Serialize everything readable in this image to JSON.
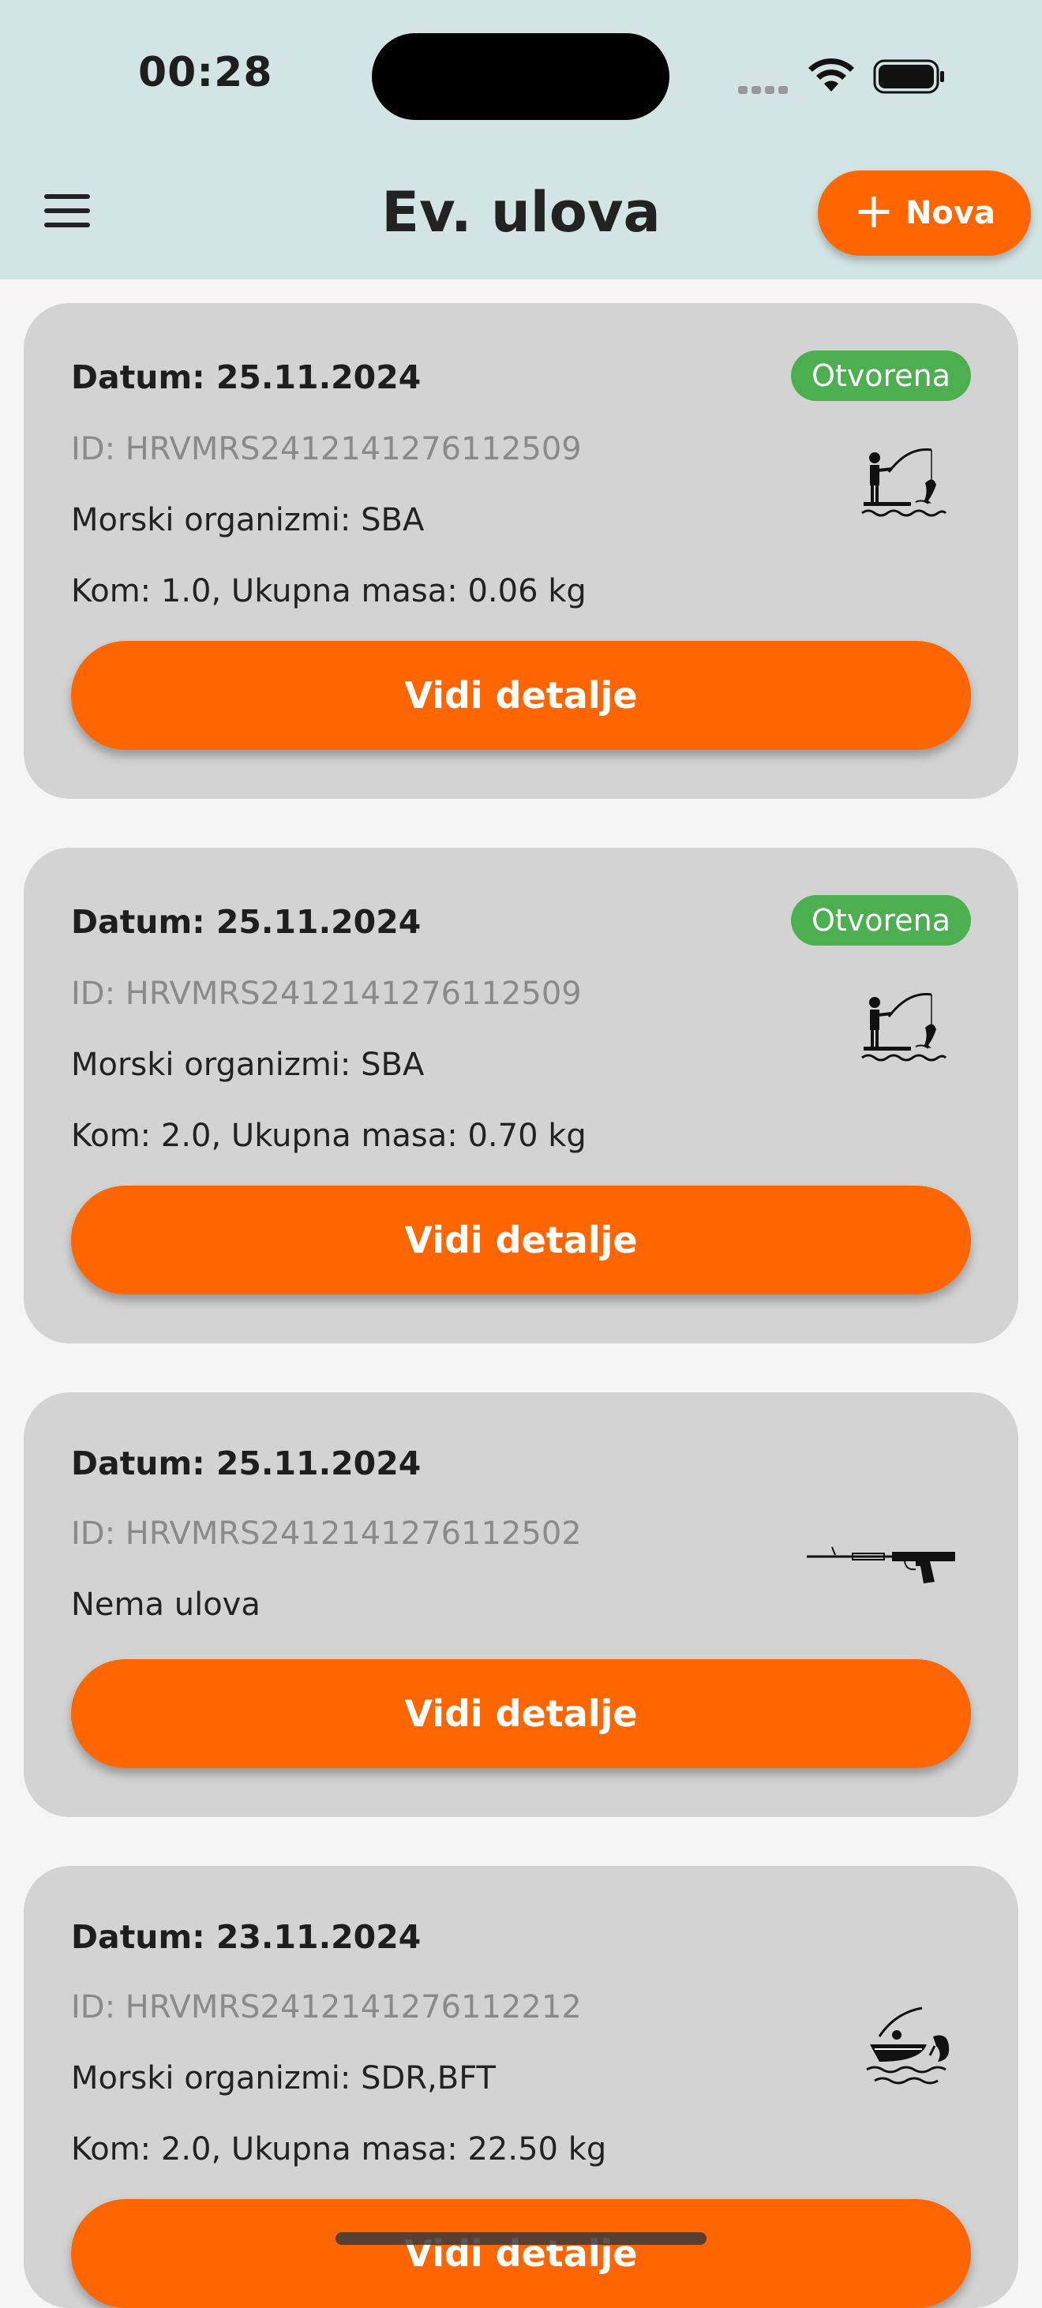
{
  "status": {
    "time": "00:28"
  },
  "header": {
    "title": "Ev. ulova",
    "new_button": "Nova"
  },
  "entries": [
    {
      "date": "Datum: 25.11.2024",
      "badge": "Otvorena",
      "id": "ID: HRVMRS2412141276112509",
      "organisms": "Morski organizmi: SBA",
      "totals": "Kom: 1.0, Ukupna masa: 0.06 kg",
      "icon": "fisherman-icon",
      "button": "Vidi detalje"
    },
    {
      "date": "Datum: 25.11.2024",
      "badge": "Otvorena",
      "id": "ID: HRVMRS2412141276112509",
      "organisms": "Morski organizmi: SBA",
      "totals": "Kom: 2.0, Ukupna masa: 0.70 kg",
      "icon": "fisherman-icon",
      "button": "Vidi detalje"
    },
    {
      "date": "Datum: 25.11.2024",
      "id": "ID: HRVMRS2412141276112502",
      "organisms": "Nema ulova",
      "icon": "speargun-icon",
      "button": "Vidi detalje"
    },
    {
      "date": "Datum: 23.11.2024",
      "id": "ID: HRVMRS2412141276112212",
      "organisms": "Morski organizmi: SDR,BFT",
      "totals": "Kom: 2.0, Ukupna masa: 22.50 kg",
      "icon": "boat-fishing-icon",
      "button": "Vidi detalje"
    }
  ],
  "colors": {
    "accent": "#ff6600",
    "header_bg": "#d2e4e3",
    "card_bg": "#d3d3d3",
    "badge": "#4caf50"
  }
}
